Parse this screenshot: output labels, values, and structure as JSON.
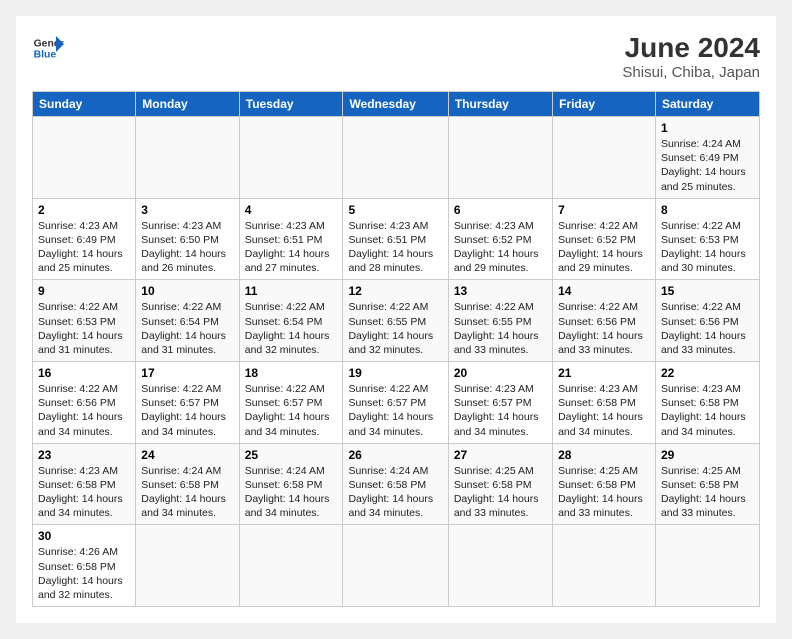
{
  "logo": {
    "general": "General",
    "blue": "Blue"
  },
  "title": "June 2024",
  "subtitle": "Shisui, Chiba, Japan",
  "days_of_week": [
    "Sunday",
    "Monday",
    "Tuesday",
    "Wednesday",
    "Thursday",
    "Friday",
    "Saturday"
  ],
  "weeks": [
    [
      {
        "day": "",
        "info": ""
      },
      {
        "day": "",
        "info": ""
      },
      {
        "day": "",
        "info": ""
      },
      {
        "day": "",
        "info": ""
      },
      {
        "day": "",
        "info": ""
      },
      {
        "day": "",
        "info": ""
      },
      {
        "day": "1",
        "info": "Sunrise: 4:24 AM\nSunset: 6:49 PM\nDaylight: 14 hours\nand 25 minutes."
      }
    ],
    [
      {
        "day": "2",
        "info": "Sunrise: 4:23 AM\nSunset: 6:49 PM\nDaylight: 14 hours\nand 25 minutes."
      },
      {
        "day": "3",
        "info": "Sunrise: 4:23 AM\nSunset: 6:50 PM\nDaylight: 14 hours\nand 26 minutes."
      },
      {
        "day": "4",
        "info": "Sunrise: 4:23 AM\nSunset: 6:51 PM\nDaylight: 14 hours\nand 27 minutes."
      },
      {
        "day": "5",
        "info": "Sunrise: 4:23 AM\nSunset: 6:51 PM\nDaylight: 14 hours\nand 28 minutes."
      },
      {
        "day": "6",
        "info": "Sunrise: 4:23 AM\nSunset: 6:52 PM\nDaylight: 14 hours\nand 29 minutes."
      },
      {
        "day": "7",
        "info": "Sunrise: 4:22 AM\nSunset: 6:52 PM\nDaylight: 14 hours\nand 29 minutes."
      },
      {
        "day": "8",
        "info": "Sunrise: 4:22 AM\nSunset: 6:53 PM\nDaylight: 14 hours\nand 30 minutes."
      }
    ],
    [
      {
        "day": "9",
        "info": "Sunrise: 4:22 AM\nSunset: 6:53 PM\nDaylight: 14 hours\nand 31 minutes."
      },
      {
        "day": "10",
        "info": "Sunrise: 4:22 AM\nSunset: 6:54 PM\nDaylight: 14 hours\nand 31 minutes."
      },
      {
        "day": "11",
        "info": "Sunrise: 4:22 AM\nSunset: 6:54 PM\nDaylight: 14 hours\nand 32 minutes."
      },
      {
        "day": "12",
        "info": "Sunrise: 4:22 AM\nSunset: 6:55 PM\nDaylight: 14 hours\nand 32 minutes."
      },
      {
        "day": "13",
        "info": "Sunrise: 4:22 AM\nSunset: 6:55 PM\nDaylight: 14 hours\nand 33 minutes."
      },
      {
        "day": "14",
        "info": "Sunrise: 4:22 AM\nSunset: 6:56 PM\nDaylight: 14 hours\nand 33 minutes."
      },
      {
        "day": "15",
        "info": "Sunrise: 4:22 AM\nSunset: 6:56 PM\nDaylight: 14 hours\nand 33 minutes."
      }
    ],
    [
      {
        "day": "16",
        "info": "Sunrise: 4:22 AM\nSunset: 6:56 PM\nDaylight: 14 hours\nand 34 minutes."
      },
      {
        "day": "17",
        "info": "Sunrise: 4:22 AM\nSunset: 6:57 PM\nDaylight: 14 hours\nand 34 minutes."
      },
      {
        "day": "18",
        "info": "Sunrise: 4:22 AM\nSunset: 6:57 PM\nDaylight: 14 hours\nand 34 minutes."
      },
      {
        "day": "19",
        "info": "Sunrise: 4:22 AM\nSunset: 6:57 PM\nDaylight: 14 hours\nand 34 minutes."
      },
      {
        "day": "20",
        "info": "Sunrise: 4:23 AM\nSunset: 6:57 PM\nDaylight: 14 hours\nand 34 minutes."
      },
      {
        "day": "21",
        "info": "Sunrise: 4:23 AM\nSunset: 6:58 PM\nDaylight: 14 hours\nand 34 minutes."
      },
      {
        "day": "22",
        "info": "Sunrise: 4:23 AM\nSunset: 6:58 PM\nDaylight: 14 hours\nand 34 minutes."
      }
    ],
    [
      {
        "day": "23",
        "info": "Sunrise: 4:23 AM\nSunset: 6:58 PM\nDaylight: 14 hours\nand 34 minutes."
      },
      {
        "day": "24",
        "info": "Sunrise: 4:24 AM\nSunset: 6:58 PM\nDaylight: 14 hours\nand 34 minutes."
      },
      {
        "day": "25",
        "info": "Sunrise: 4:24 AM\nSunset: 6:58 PM\nDaylight: 14 hours\nand 34 minutes."
      },
      {
        "day": "26",
        "info": "Sunrise: 4:24 AM\nSunset: 6:58 PM\nDaylight: 14 hours\nand 34 minutes."
      },
      {
        "day": "27",
        "info": "Sunrise: 4:25 AM\nSunset: 6:58 PM\nDaylight: 14 hours\nand 33 minutes."
      },
      {
        "day": "28",
        "info": "Sunrise: 4:25 AM\nSunset: 6:58 PM\nDaylight: 14 hours\nand 33 minutes."
      },
      {
        "day": "29",
        "info": "Sunrise: 4:25 AM\nSunset: 6:58 PM\nDaylight: 14 hours\nand 33 minutes."
      }
    ],
    [
      {
        "day": "30",
        "info": "Sunrise: 4:26 AM\nSunset: 6:58 PM\nDaylight: 14 hours\nand 32 minutes."
      },
      {
        "day": "",
        "info": ""
      },
      {
        "day": "",
        "info": ""
      },
      {
        "day": "",
        "info": ""
      },
      {
        "day": "",
        "info": ""
      },
      {
        "day": "",
        "info": ""
      },
      {
        "day": "",
        "info": ""
      }
    ]
  ]
}
